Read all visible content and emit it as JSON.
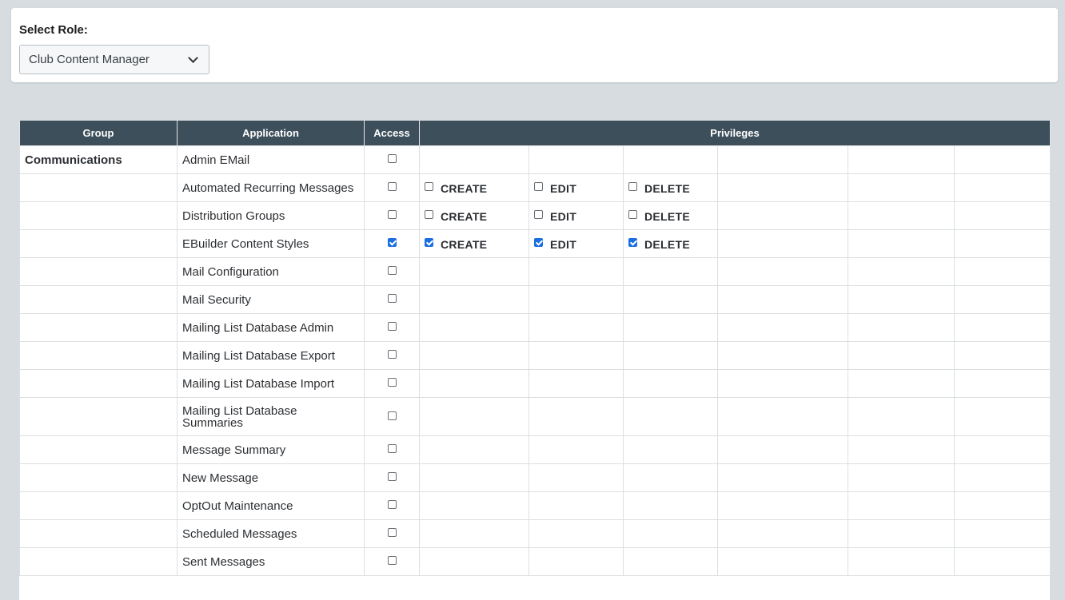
{
  "role": {
    "label": "Select Role:",
    "selected": "Club Content Manager"
  },
  "table": {
    "headers": {
      "group": "Group",
      "application": "Application",
      "access": "Access",
      "privileges": "Privileges"
    },
    "group_name": "Communications",
    "rows": [
      {
        "app": "Admin EMail",
        "access": false,
        "privileges": []
      },
      {
        "app": "Automated Recurring Messages",
        "access": false,
        "privileges": [
          {
            "label": "CREATE",
            "checked": false
          },
          {
            "label": "EDIT",
            "checked": false
          },
          {
            "label": "DELETE",
            "checked": false
          }
        ]
      },
      {
        "app": "Distribution Groups",
        "access": false,
        "privileges": [
          {
            "label": "CREATE",
            "checked": false
          },
          {
            "label": "EDIT",
            "checked": false
          },
          {
            "label": "DELETE",
            "checked": false
          }
        ]
      },
      {
        "app": "EBuilder Content Styles",
        "access": true,
        "privileges": [
          {
            "label": "CREATE",
            "checked": true
          },
          {
            "label": "EDIT",
            "checked": true
          },
          {
            "label": "DELETE",
            "checked": true
          }
        ]
      },
      {
        "app": "Mail Configuration",
        "access": false,
        "privileges": []
      },
      {
        "app": "Mail Security",
        "access": false,
        "privileges": []
      },
      {
        "app": "Mailing List Database Admin",
        "access": false,
        "privileges": []
      },
      {
        "app": "Mailing List Database Export",
        "access": false,
        "privileges": []
      },
      {
        "app": "Mailing List Database Import",
        "access": false,
        "privileges": []
      },
      {
        "app": "Mailing List Database Summaries",
        "access": false,
        "privileges": [],
        "tall": true
      },
      {
        "app": "Message Summary",
        "access": false,
        "privileges": []
      },
      {
        "app": "New Message",
        "access": false,
        "privileges": []
      },
      {
        "app": "OptOut Maintenance",
        "access": false,
        "privileges": []
      },
      {
        "app": "Scheduled Messages",
        "access": false,
        "privileges": []
      },
      {
        "app": "Sent Messages",
        "access": false,
        "privileges": []
      }
    ]
  }
}
